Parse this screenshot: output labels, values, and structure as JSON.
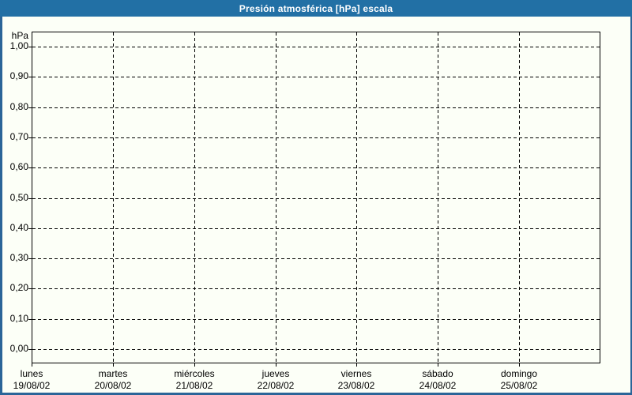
{
  "window": {
    "title": "Presión atmosférica [hPa] escala"
  },
  "colors": {
    "titlebar_bg": "#2270A5",
    "titlebar_text": "#FFFFFF",
    "window_border": "#2B6598",
    "background": "#FCFFF7",
    "grid_line": "#000000",
    "label_text": "#000000"
  },
  "chart_data": {
    "type": "line",
    "title": "Presión atmosférica [hPa] escala",
    "ylabel": "hPa",
    "ylim": [
      0.0,
      1.0
    ],
    "y_tick_step": 0.1,
    "y_tick_labels_top_to_bottom": [
      "1,00",
      "0,90",
      "0,80",
      "0,70",
      "0,60",
      "0,50",
      "0,40",
      "0,30",
      "0,20",
      "0,10",
      "0,00"
    ],
    "x_axis_days": [
      {
        "day": "lunes",
        "date": "19/08/02"
      },
      {
        "day": "martes",
        "date": "20/08/02"
      },
      {
        "day": "miércoles",
        "date": "21/08/02"
      },
      {
        "day": "jueves",
        "date": "22/08/02"
      },
      {
        "day": "viernes",
        "date": "23/08/02"
      },
      {
        "day": "sábado",
        "date": "24/08/02"
      },
      {
        "day": "domingo",
        "date": "25/08/02"
      }
    ],
    "grid": "dashed",
    "legend_position": "none",
    "series": []
  }
}
